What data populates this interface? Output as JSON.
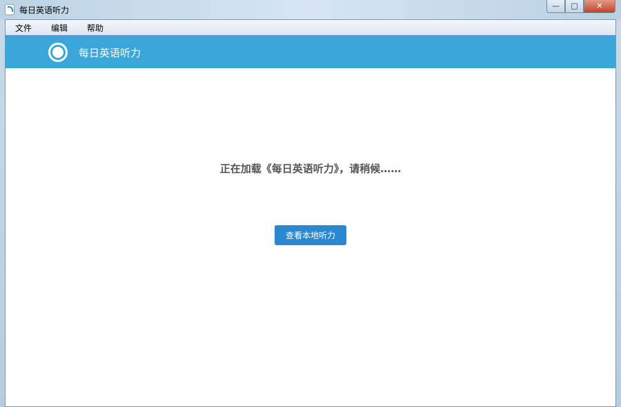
{
  "window": {
    "title": "每日英语听力",
    "controls": {
      "minimize": "—",
      "maximize": "□",
      "close": "✕"
    }
  },
  "menu": [
    "文件",
    "编辑",
    "帮助"
  ],
  "header": {
    "title": "每日英语听力"
  },
  "main": {
    "loading_text": "正在加载《每日英语听力》，请稍候……",
    "local_button": "查看本地听力"
  },
  "colors": {
    "header": "#3aa6d9",
    "button": "#2a87d0"
  }
}
